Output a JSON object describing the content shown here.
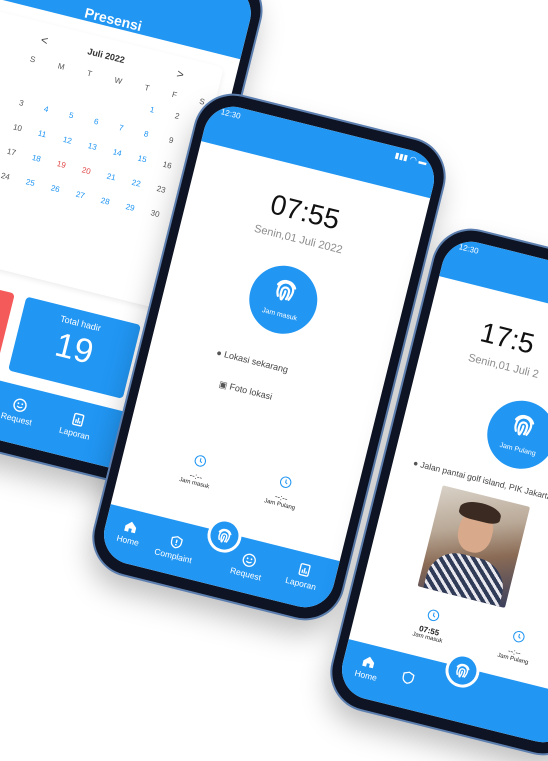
{
  "left": {
    "title": "Presensi",
    "month": "Juli 2022",
    "prev": "<",
    "next": ">",
    "weekdays": [
      "S",
      "M",
      "T",
      "W",
      "T",
      "F",
      "S"
    ],
    "days": [
      "",
      "",
      "",
      "",
      "",
      "1",
      "2",
      "3",
      "4",
      "5",
      "6",
      "7",
      "8",
      "9",
      "10",
      "11",
      "12",
      "13",
      "14",
      "15",
      "16",
      "17",
      "18",
      "19",
      "20",
      "21",
      "22",
      "23",
      "24",
      "25",
      "26",
      "27",
      "28",
      "29",
      "30"
    ],
    "stat_label": "Total hadir",
    "stat_value": "19",
    "nav": [
      "Request",
      "Laporan"
    ]
  },
  "middle": {
    "clock": "12:30",
    "time": "07:55",
    "date": "Senin,01 Juli 2022",
    "button": "Jam masuk",
    "location": "Lokasi sekarang",
    "photo": "Foto lokasi",
    "stats": [
      {
        "value": "--:--",
        "label": "Jam masuk"
      },
      {
        "value": "--:--",
        "label": "Jam Pulang"
      }
    ],
    "nav": [
      "Home",
      "Complaint",
      "Request",
      "Laporan"
    ]
  },
  "right": {
    "clock": "12:30",
    "time": "17:5",
    "date": "Senin,01 Juli 2",
    "button": "Jam Pulang",
    "location": "Jalan pantai golf island, PIK Jakarta",
    "stats": [
      {
        "value": "07:55",
        "label": "Jam masuk"
      },
      {
        "value": "--:--",
        "label": "Jam Pulang"
      }
    ],
    "nav": [
      "Home"
    ]
  }
}
